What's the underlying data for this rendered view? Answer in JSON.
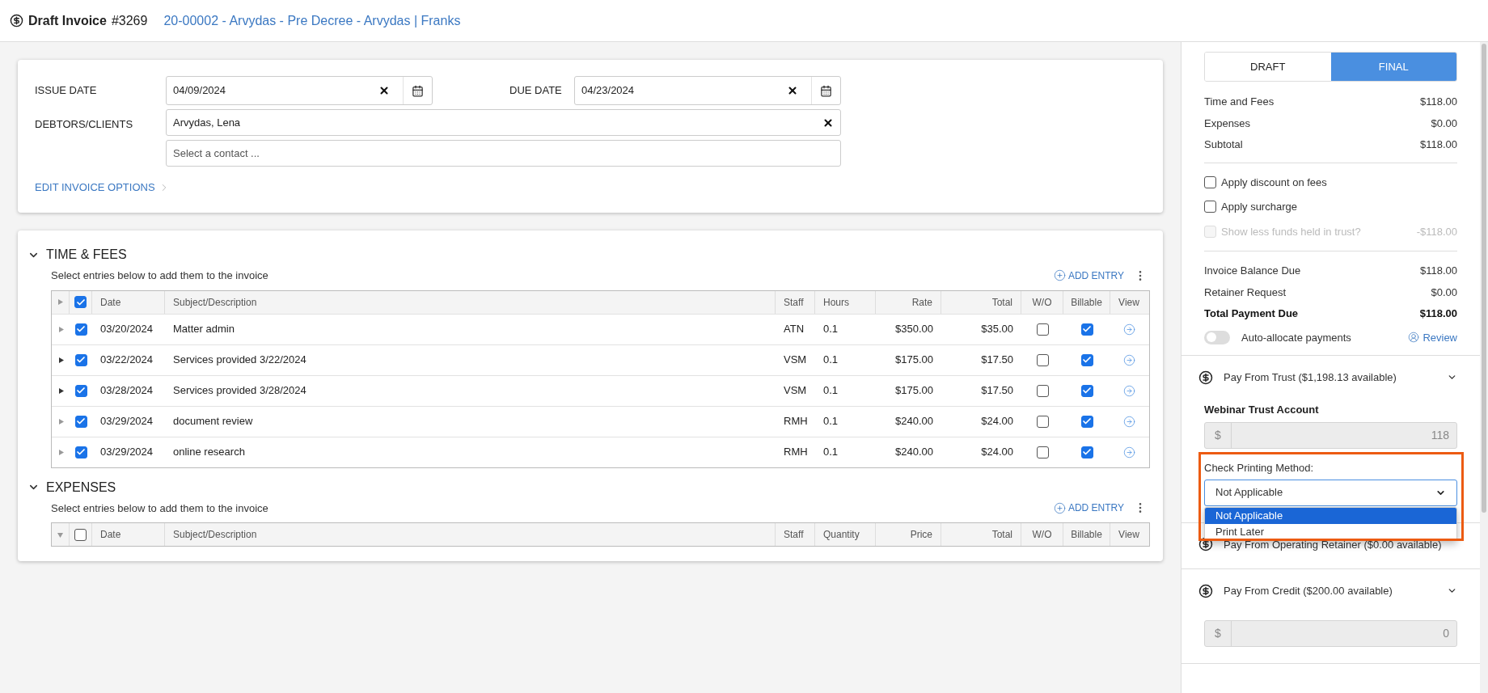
{
  "header": {
    "title": "Draft Invoice",
    "number": "#3269",
    "matter": "20-00002 - Arvydas - Pre Decree - Arvydas | Franks"
  },
  "form": {
    "issue_label": "ISSUE DATE",
    "issue_value": "04/09/2024",
    "due_label": "DUE DATE",
    "due_value": "04/23/2024",
    "debtors_label": "DEBTORS/CLIENTS",
    "debtor_value": "Arvydas, Lena",
    "contact_placeholder": "Select a contact ...",
    "edit_options": "EDIT INVOICE OPTIONS"
  },
  "sections": [
    {
      "title": "TIME & FEES",
      "subtitle": "Select entries below to add them to the invoice",
      "add_entry": "ADD ENTRY",
      "expanded": false,
      "all_checked": true,
      "columns": [
        {
          "label": "Date",
          "kind": "text"
        },
        {
          "label": "Subject/Description",
          "kind": "text"
        },
        {
          "label": "Staff",
          "kind": "text"
        },
        {
          "label": "Hours",
          "kind": "text"
        },
        {
          "label": "Rate",
          "kind": "amount"
        },
        {
          "label": "Total",
          "kind": "amount"
        },
        {
          "label": "W/O",
          "kind": "flag"
        },
        {
          "label": "Billable",
          "kind": "flag"
        },
        {
          "label": "View",
          "kind": "flag"
        }
      ],
      "rows": [
        {
          "has_details": false,
          "checked": true,
          "date": "03/20/2024",
          "subject": "Matter admin",
          "staff": "ATN",
          "hours": "0.1",
          "rate": "$350.00",
          "total": "$35.00",
          "write_off": false,
          "billable": true
        },
        {
          "has_details": true,
          "checked": true,
          "date": "03/22/2024",
          "subject": "Services provided 3/22/2024",
          "staff": "VSM",
          "hours": "0.1",
          "rate": "$175.00",
          "total": "$17.50",
          "write_off": false,
          "billable": true
        },
        {
          "has_details": true,
          "checked": true,
          "date": "03/28/2024",
          "subject": "Services provided 3/28/2024",
          "staff": "VSM",
          "hours": "0.1",
          "rate": "$175.00",
          "total": "$17.50",
          "write_off": false,
          "billable": true
        },
        {
          "has_details": false,
          "checked": true,
          "date": "03/29/2024",
          "subject": "document review",
          "staff": "RMH",
          "hours": "0.1",
          "rate": "$240.00",
          "total": "$24.00",
          "write_off": false,
          "billable": true
        },
        {
          "has_details": false,
          "checked": true,
          "date": "03/29/2024",
          "subject": "online research",
          "staff": "RMH",
          "hours": "0.1",
          "rate": "$240.00",
          "total": "$24.00",
          "write_off": false,
          "billable": true
        }
      ]
    },
    {
      "title": "EXPENSES",
      "subtitle": "Select entries below to add them to the invoice",
      "add_entry": "ADD ENTRY",
      "expanded": true,
      "all_checked": false,
      "columns": [
        {
          "label": "Date",
          "kind": "text"
        },
        {
          "label": "Subject/Description",
          "kind": "text"
        },
        {
          "label": "Staff",
          "kind": "text"
        },
        {
          "label": "Quantity",
          "kind": "text"
        },
        {
          "label": "Price",
          "kind": "amount"
        },
        {
          "label": "Total",
          "kind": "amount"
        },
        {
          "label": "W/O",
          "kind": "flag"
        },
        {
          "label": "Billable",
          "kind": "flag"
        },
        {
          "label": "View",
          "kind": "flag"
        }
      ]
    }
  ],
  "panel": {
    "status_options": [
      {
        "label": "DRAFT",
        "selected": false
      },
      {
        "label": "FINAL",
        "selected": true
      }
    ],
    "summary": [
      {
        "label": "Time and Fees",
        "amount": "$118.00"
      },
      {
        "label": "Expenses",
        "amount": "$0.00"
      },
      {
        "label": "Subtotal",
        "amount": "$118.00"
      }
    ],
    "options": [
      {
        "label": "Apply discount on fees",
        "checked": false,
        "disabled": false
      },
      {
        "label": "Apply surcharge",
        "checked": false,
        "disabled": false
      },
      {
        "label": "Show less funds held in trust?",
        "checked": false,
        "disabled": true,
        "amount": "-$118.00"
      }
    ],
    "balance": [
      {
        "label": "Invoice Balance Due",
        "amount": "$118.00",
        "kind": "normal"
      },
      {
        "label": "Retainer Request",
        "amount": "$0.00",
        "kind": "normal"
      },
      {
        "label": "Total Payment Due",
        "amount": "$118.00",
        "kind": "total"
      }
    ],
    "auto_allocate": {
      "label": "Auto-allocate payments",
      "on": false
    },
    "review": "Review",
    "payments": [
      {
        "title": "Pay From Trust ($1,198.13 available)",
        "expandable": true,
        "account": "Webinar Trust Account",
        "currency_symbol": "$",
        "value": "118",
        "check_method": {
          "label": "Check Printing Method:",
          "value": "Not Applicable",
          "open": true,
          "options": [
            {
              "label": "Not Applicable",
              "selected": true
            },
            {
              "label": "Print Later",
              "selected": false
            }
          ]
        }
      },
      {
        "title": "Pay From Operating Retainer ($0.00 available)",
        "expandable": false
      },
      {
        "title": "Pay From Credit ($200.00 available)",
        "expandable": true,
        "currency_symbol": "$",
        "value": "0"
      }
    ]
  }
}
